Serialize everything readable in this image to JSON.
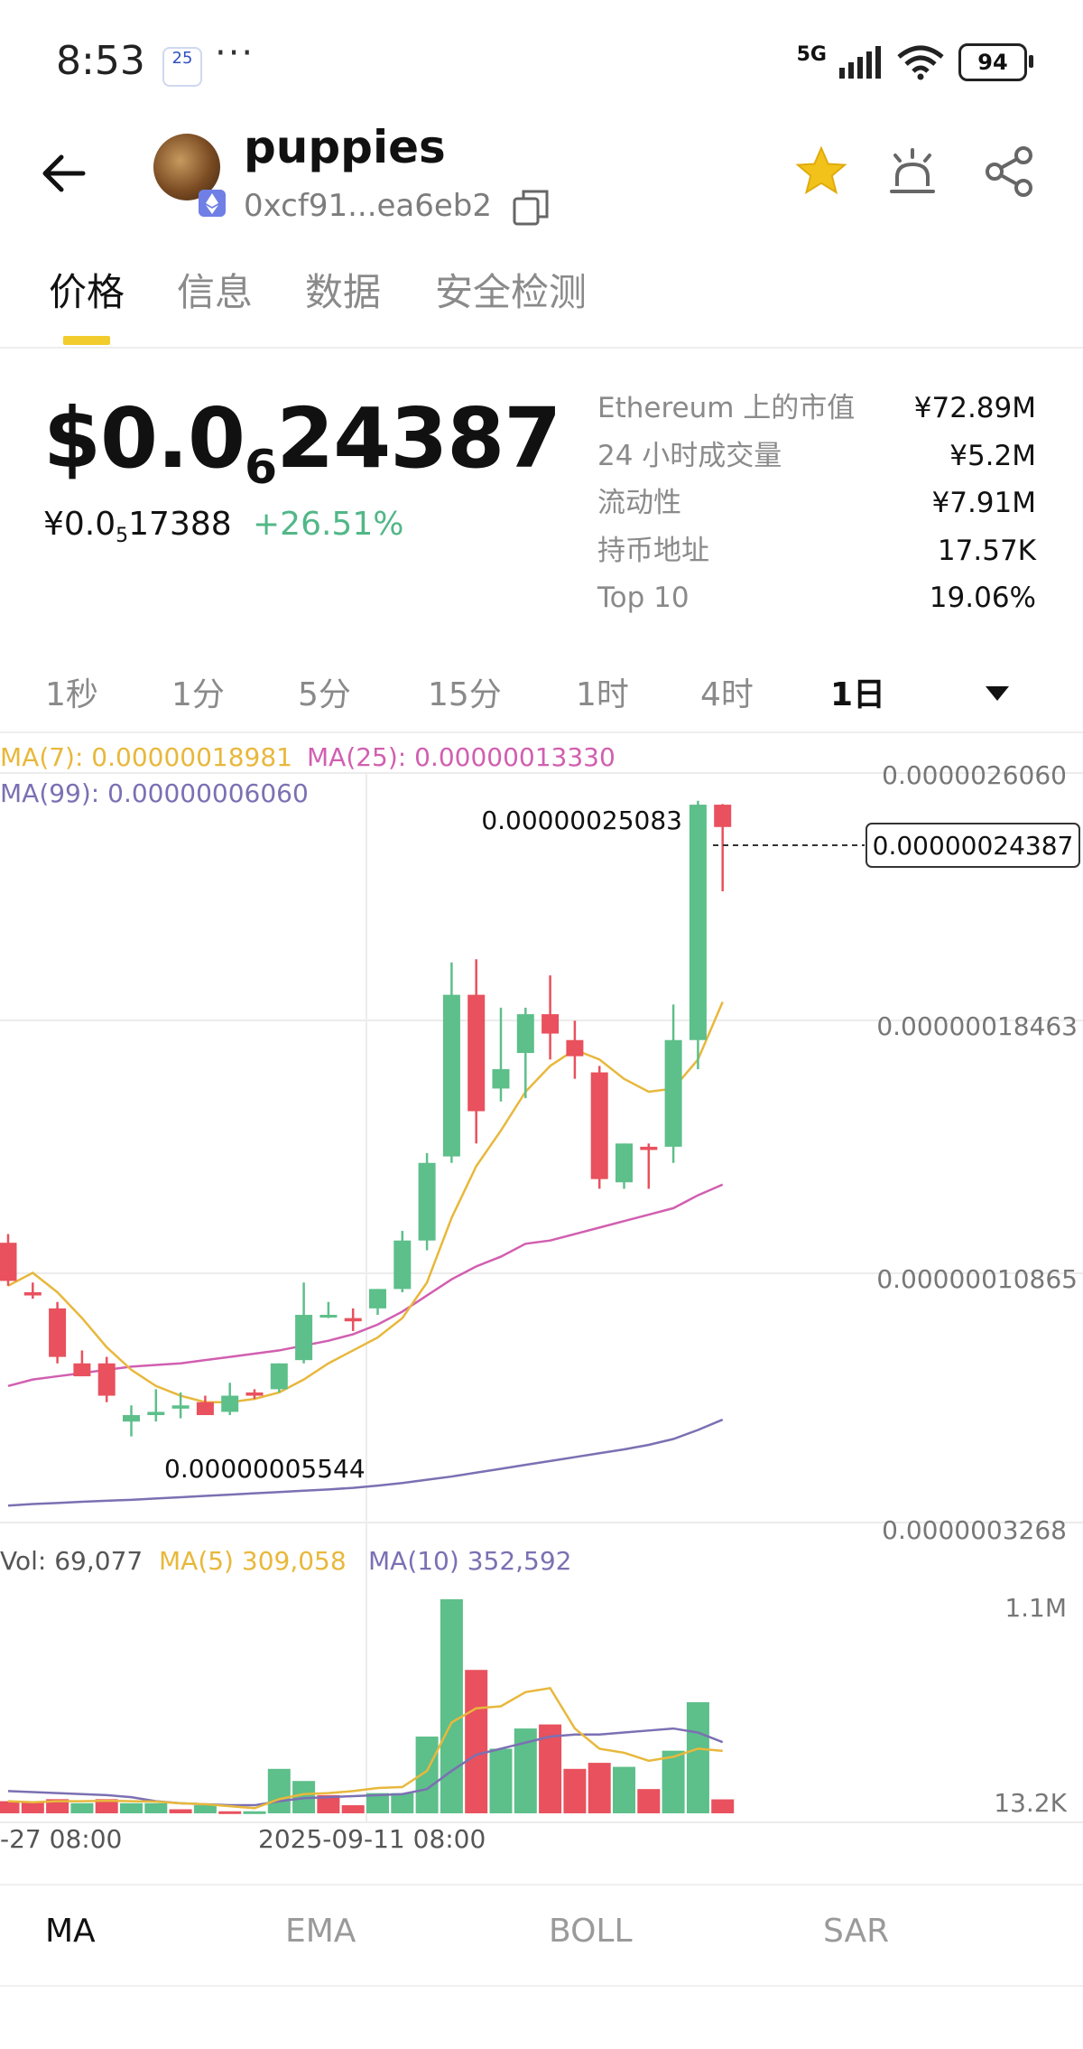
{
  "status_bar": {
    "time": "8:53",
    "calendar_badge": "25",
    "dots": "···",
    "network": "5G",
    "battery": "94"
  },
  "header": {
    "token_name": "puppies",
    "address": "0xcf91...ea6eb2",
    "icons": [
      "back-arrow-icon",
      "ethereum-icon",
      "copy-icon",
      "star-icon",
      "alert-bell-icon",
      "share-icon"
    ],
    "star_color": "#f2c21a"
  },
  "tabs": [
    {
      "label": "价格",
      "active": true
    },
    {
      "label": "信息",
      "active": false
    },
    {
      "label": "数据",
      "active": false
    },
    {
      "label": "安全检测",
      "active": false
    }
  ],
  "price": {
    "usd_prefix": "$0.0",
    "usd_zeros": "6",
    "usd_digits": "24387",
    "cny_prefix": "¥0.0",
    "cny_zeros": "5",
    "cny_digits": "17388",
    "change": "+26.51%",
    "change_color": "#52b788"
  },
  "stats": [
    {
      "label": "Ethereum 上的市值",
      "value": "¥72.89M"
    },
    {
      "label": "24 小时成交量",
      "value": "¥5.2M"
    },
    {
      "label": "流动性",
      "value": "¥7.91M"
    },
    {
      "label": "持币地址",
      "value": "17.57K"
    },
    {
      "label": "Top 10",
      "value": "19.06%"
    }
  ],
  "intervals": [
    {
      "label": "1秒",
      "active": false
    },
    {
      "label": "1分",
      "active": false
    },
    {
      "label": "5分",
      "active": false
    },
    {
      "label": "15分",
      "active": false
    },
    {
      "label": "1时",
      "active": false
    },
    {
      "label": "4时",
      "active": false
    },
    {
      "label": "1日",
      "active": true
    }
  ],
  "chart_data": {
    "type": "candlestick",
    "price_axis_ticks": [
      "0.0000026060",
      "0.00000018463",
      "0.00000010865",
      "0.0000003268"
    ],
    "ma_legend": {
      "ma7": "MA(7): 0.00000018981",
      "ma25": "MA(25): 0.00000013330",
      "ma99": "MA(99): 0.00000006060"
    },
    "high_label": "0.00000025083",
    "low_label": "0.00000005544",
    "last_price_label": "0.00000024387",
    "x_labels": [
      "-27 08:00",
      "2025-09-11 08:00"
    ],
    "colors": {
      "up": "#5dbf8a",
      "down": "#e8515d",
      "ma7": "#e8b83c",
      "ma25": "#d15fb0",
      "ma99": "#7b70b3"
    },
    "ylim": [
      3.268e-08,
      2.606e-07
    ],
    "candles": [
      {
        "o": 1.153e-07,
        "h": 1.18e-07,
        "l": 1.02e-07,
        "c": 1.035e-07
      },
      {
        "o": 1e-07,
        "h": 1.03e-07,
        "l": 9.8e-08,
        "c": 9.9e-08
      },
      {
        "o": 9.5e-08,
        "h": 9.7e-08,
        "l": 7.8e-08,
        "c": 8e-08
      },
      {
        "o": 7.8e-08,
        "h": 8.2e-08,
        "l": 7.4e-08,
        "c": 7.4e-08
      },
      {
        "o": 7.8e-08,
        "h": 8e-08,
        "l": 6.6e-08,
        "c": 6.8e-08
      },
      {
        "o": 6e-08,
        "h": 6.5e-08,
        "l": 5.54e-08,
        "c": 6.2e-08
      },
      {
        "o": 6.2e-08,
        "h": 7e-08,
        "l": 6e-08,
        "c": 6.3e-08
      },
      {
        "o": 6.4e-08,
        "h": 6.9e-08,
        "l": 6.1e-08,
        "c": 6.5e-08
      },
      {
        "o": 6.6e-08,
        "h": 6.8e-08,
        "l": 6.2e-08,
        "c": 6.2e-08
      },
      {
        "o": 6.3e-08,
        "h": 7.2e-08,
        "l": 6.2e-08,
        "c": 6.8e-08
      },
      {
        "o": 6.9e-08,
        "h": 7e-08,
        "l": 6.7e-08,
        "c": 6.8e-08
      },
      {
        "o": 7e-08,
        "h": 7.8e-08,
        "l": 6.9e-08,
        "c": 7.8e-08
      },
      {
        "o": 7.9e-08,
        "h": 1.03e-07,
        "l": 7.8e-08,
        "c": 9.3e-08
      },
      {
        "o": 9.3e-08,
        "h": 9.7e-08,
        "l": 9.2e-08,
        "c": 9.3e-08
      },
      {
        "o": 9.2e-08,
        "h": 9.5e-08,
        "l": 8.8e-08,
        "c": 9.1e-08
      },
      {
        "o": 9.5e-08,
        "h": 1.01e-07,
        "l": 9.3e-08,
        "c": 1.01e-07
      },
      {
        "o": 1.01e-07,
        "h": 1.19e-07,
        "l": 1e-07,
        "c": 1.16e-07
      },
      {
        "o": 1.16e-07,
        "h": 1.43e-07,
        "l": 1.13e-07,
        "c": 1.4e-07
      },
      {
        "o": 1.42e-07,
        "h": 2.02e-07,
        "l": 1.4e-07,
        "c": 1.92e-07
      },
      {
        "o": 1.92e-07,
        "h": 2.03e-07,
        "l": 1.46e-07,
        "c": 1.56e-07
      },
      {
        "o": 1.63e-07,
        "h": 1.88e-07,
        "l": 1.59e-07,
        "c": 1.69e-07
      },
      {
        "o": 1.74e-07,
        "h": 1.88e-07,
        "l": 1.6e-07,
        "c": 1.86e-07
      },
      {
        "o": 1.86e-07,
        "h": 1.98e-07,
        "l": 1.72e-07,
        "c": 1.8e-07
      },
      {
        "o": 1.78e-07,
        "h": 1.84e-07,
        "l": 1.66e-07,
        "c": 1.73e-07
      },
      {
        "o": 1.68e-07,
        "h": 1.7e-07,
        "l": 1.32e-07,
        "c": 1.35e-07
      },
      {
        "o": 1.34e-07,
        "h": 1.46e-07,
        "l": 1.32e-07,
        "c": 1.46e-07
      },
      {
        "o": 1.45e-07,
        "h": 1.46e-07,
        "l": 1.32e-07,
        "c": 1.44e-07
      },
      {
        "o": 1.45e-07,
        "h": 1.89e-07,
        "l": 1.4e-07,
        "c": 1.78e-07
      },
      {
        "o": 1.78e-07,
        "h": 2.52e-07,
        "l": 1.69e-07,
        "c": 2.508e-07
      },
      {
        "o": 2.508e-07,
        "h": 2.51e-07,
        "l": 2.24e-07,
        "c": 2.439e-07
      }
    ],
    "ma7_values": [
      1.02e-07,
      1.06e-07,
      1e-07,
      9.2e-08,
      8.3e-08,
      7.6e-08,
      7.1e-08,
      6.8e-08,
      6.6e-08,
      6.6e-08,
      6.7e-08,
      6.9e-08,
      7.3e-08,
      7.8e-08,
      8.2e-08,
      8.6e-08,
      9.2e-08,
      1.03e-07,
      1.23e-07,
      1.39e-07,
      1.5e-07,
      1.62e-07,
      1.7e-07,
      1.75e-07,
      1.72e-07,
      1.66e-07,
      1.62e-07,
      1.63e-07,
      1.72e-07,
      1.898e-07
    ],
    "ma25_values": [
      7.1e-08,
      7.3e-08,
      7.4e-08,
      7.5e-08,
      7.6e-08,
      7.7e-08,
      7.75e-08,
      7.8e-08,
      7.9e-08,
      8e-08,
      8.1e-08,
      8.2e-08,
      8.35e-08,
      8.5e-08,
      8.7e-08,
      9e-08,
      9.4e-08,
      9.9e-08,
      1.04e-07,
      1.08e-07,
      1.11e-07,
      1.15e-07,
      1.16e-07,
      1.18e-07,
      1.2e-07,
      1.22e-07,
      1.24e-07,
      1.26e-07,
      1.3e-07,
      1.333e-07
    ],
    "ma99_values": [
      3.4e-08,
      3.45e-08,
      3.48e-08,
      3.52e-08,
      3.55e-08,
      3.58e-08,
      3.62e-08,
      3.66e-08,
      3.7e-08,
      3.74e-08,
      3.78e-08,
      3.82e-08,
      3.86e-08,
      3.9e-08,
      3.95e-08,
      4.02e-08,
      4.1e-08,
      4.2e-08,
      4.3e-08,
      4.42e-08,
      4.54e-08,
      4.66e-08,
      4.78e-08,
      4.9e-08,
      5.02e-08,
      5.14e-08,
      5.28e-08,
      5.46e-08,
      5.74e-08,
      6.06e-08
    ],
    "volume": {
      "legend": {
        "vol": "Vol: 69,077",
        "ma5": "MA(5) 309,058",
        "ma10": "MA(10) 352,592"
      },
      "axis_ticks": [
        "1.1M",
        "13.2K"
      ],
      "ylim": [
        0,
        1100000
      ],
      "bars": [
        {
          "v": 60000,
          "up": false
        },
        {
          "v": 60000,
          "up": false
        },
        {
          "v": 70000,
          "up": false
        },
        {
          "v": 50000,
          "up": true
        },
        {
          "v": 70000,
          "up": false
        },
        {
          "v": 50000,
          "up": true
        },
        {
          "v": 50000,
          "up": true
        },
        {
          "v": 20000,
          "up": false
        },
        {
          "v": 40000,
          "up": true
        },
        {
          "v": 10000,
          "up": false
        },
        {
          "v": 10000,
          "up": true
        },
        {
          "v": 220000,
          "up": true
        },
        {
          "v": 160000,
          "up": true
        },
        {
          "v": 90000,
          "up": false
        },
        {
          "v": 40000,
          "up": false
        },
        {
          "v": 100000,
          "up": true
        },
        {
          "v": 100000,
          "up": true
        },
        {
          "v": 380000,
          "up": true
        },
        {
          "v": 1060000,
          "up": true
        },
        {
          "v": 710000,
          "up": false
        },
        {
          "v": 320000,
          "up": true
        },
        {
          "v": 420000,
          "up": true
        },
        {
          "v": 440000,
          "up": false
        },
        {
          "v": 220000,
          "up": false
        },
        {
          "v": 250000,
          "up": false
        },
        {
          "v": 230000,
          "up": true
        },
        {
          "v": 120000,
          "up": false
        },
        {
          "v": 310000,
          "up": true
        },
        {
          "v": 550000,
          "up": true
        },
        {
          "v": 69077,
          "up": false
        }
      ],
      "ma5_values": [
        60000,
        55000,
        60000,
        60000,
        62000,
        60000,
        58000,
        50000,
        45000,
        35000,
        25000,
        70000,
        95000,
        100000,
        110000,
        125000,
        130000,
        210000,
        450000,
        520000,
        530000,
        600000,
        620000,
        420000,
        320000,
        300000,
        260000,
        280000,
        320000,
        309058
      ],
      "ma10_values": [
        110000,
        105000,
        100000,
        95000,
        90000,
        80000,
        60000,
        50000,
        45000,
        40000,
        40000,
        60000,
        75000,
        80000,
        85000,
        90000,
        95000,
        120000,
        210000,
        290000,
        320000,
        350000,
        380000,
        390000,
        390000,
        400000,
        410000,
        420000,
        400000,
        352592
      ]
    }
  },
  "indicator_tabs": [
    {
      "label": "MA",
      "active": true
    },
    {
      "label": "EMA",
      "active": false
    },
    {
      "label": "BOLL",
      "active": false
    },
    {
      "label": "SAR",
      "active": false
    }
  ]
}
